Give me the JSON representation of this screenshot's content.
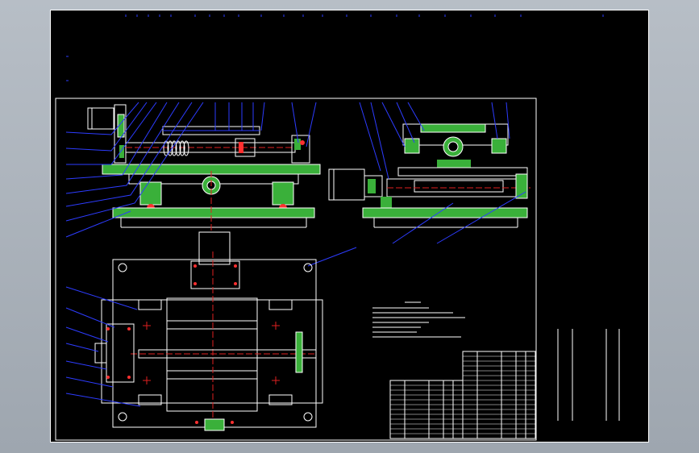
{
  "window": {
    "background": "#a9b0b8",
    "sheet_color": "#000000"
  },
  "drawing": {
    "colors": {
      "outline": "#ffffff",
      "part_fill": "#3ab03a",
      "leader": "#2d3cff",
      "hatch": "#ff3030",
      "axis": "#e02020",
      "dim_text": "#ffffff"
    },
    "views": [
      "front-section-view",
      "side-section-view",
      "top-view"
    ],
    "title_block": {
      "present": true
    },
    "technical_requirements": {
      "present": true
    }
  }
}
